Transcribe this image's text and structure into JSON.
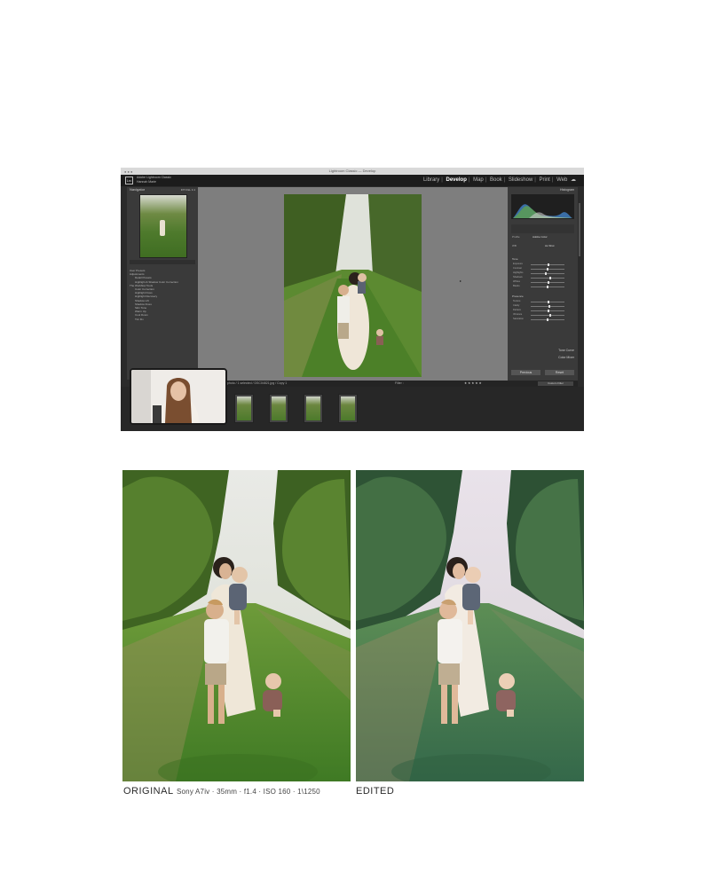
{
  "lightroom": {
    "window_title": "Lightroom Classic — Develop",
    "identity_plate": {
      "logo": "Lrc",
      "user_line1": "Adobe Lightroom Classic",
      "user_line2": "Hannah Marie"
    },
    "modules": [
      "Library",
      "Develop",
      "Map",
      "Book",
      "Slideshow",
      "Print",
      "Web"
    ],
    "active_module": "Develop",
    "left_panel": {
      "navigator_title": "Navigator",
      "navigator_zoom": "FIT  FILL  1:1",
      "presets_header": "Presets",
      "items": [
        "User Presets",
        "Adjustments",
        "Detail Presets",
        "Highlight & Shadow Color Correction",
        "The Workflow Tools",
        "Color Correction",
        "Highlight Fixes",
        "Highlight Recovery",
        "Shadow Lift",
        "Shadow Fixes",
        "Skin Tone",
        "Warm Up",
        "Cool Down",
        "Tint Fix"
      ]
    },
    "right_panel": {
      "histogram_title": "Histogram",
      "profile_label": "Profile",
      "profile_value": "Adobe Color",
      "wb_label": "WB",
      "wb_value": "As Shot",
      "tone_label": "Tone",
      "presence_label": "Presence",
      "tone_curve": "Tone Curve",
      "color_mixer": "Color Mixer",
      "sliders": [
        "Exposure",
        "Contrast",
        "Highlights",
        "Shadows",
        "Whites",
        "Blacks"
      ],
      "presence_sliders": [
        "Texture",
        "Clarity",
        "Dehaze",
        "Vibrance",
        "Saturation"
      ],
      "previous_button": "Previous",
      "reset_button": "Reset",
      "custom_filter": "Custom Filter"
    },
    "toolbar_text": "1 photo / 1 selected / DSC04821.jpg / Copy 1",
    "filter_label": "Filter :",
    "colors": {
      "panel": "#3a3a3a",
      "background": "#7e7e7e",
      "film": "#272727"
    }
  },
  "captions": {
    "original": "ORIGINAL",
    "specs": "Sony A7iv · 35mm · f1.4 · ISO 160 · 1\\1250",
    "edited": "EDITED"
  }
}
